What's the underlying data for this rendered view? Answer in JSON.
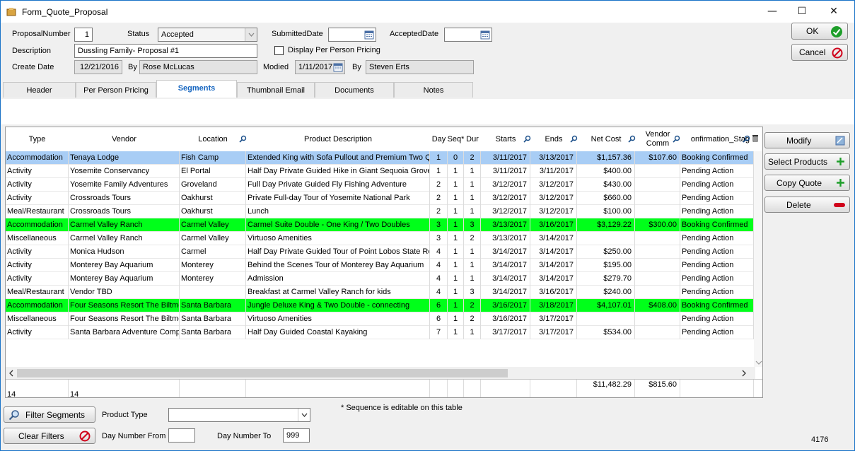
{
  "window": {
    "title": "Form_Quote_Proposal"
  },
  "form": {
    "proposal_number_label": "ProposalNumber",
    "proposal_number": "1",
    "status_label": "Status",
    "status": "Accepted",
    "submitted_label": "SubmittedDate",
    "submitted_value": "",
    "accepted_label": "AcceptedDate",
    "accepted_value": "",
    "description_label": "Description",
    "description": "Dussling Family- Proposal #1",
    "per_person_label": "Display Per Person Pricing",
    "create_date_label": "Create Date",
    "create_date": "12/21/2016",
    "by_label": "By",
    "created_by": "Rose McLucas",
    "modified_label": "Modied",
    "modified_date": "1/11/2017",
    "by2_label": "By",
    "modified_by": "Steven Erts"
  },
  "buttons": {
    "ok": "OK",
    "cancel": "Cancel",
    "modify": "Modify",
    "select_products": "Select Products",
    "copy_quote": "Copy Quote",
    "delete": "Delete",
    "filter_segments": "Filter Segments",
    "clear_filters": "Clear Filters"
  },
  "tabs": [
    {
      "label": "Header"
    },
    {
      "label": "Per Person Pricing"
    },
    {
      "label": "Segments"
    },
    {
      "label": "Thumbnail Email"
    },
    {
      "label": "Documents"
    },
    {
      "label": "Notes"
    }
  ],
  "grid": {
    "headers": {
      "type": "Type",
      "vendor": "Vendor",
      "location": "Location",
      "product": "Product Description",
      "day": "Day",
      "seq": "Seq*",
      "dur": "Dur",
      "starts": "Starts",
      "ends": "Ends",
      "net_cost": "Net Cost",
      "vendor_comm": "Vendor Comm",
      "conf": "onfirmation_Stag"
    },
    "rows": [
      [
        "Accommodation",
        "Tenaya Lodge",
        "Fish Camp",
        "Extended King with Sofa Pullout and Premium Two Queen",
        "1",
        "0",
        "2",
        "3/11/2017",
        "3/13/2017",
        "$1,157.36",
        "$107.60",
        "Booking Confirmed"
      ],
      [
        "Activity",
        "Yosemite Conservancy",
        "El Portal",
        "Half Day Private Guided Hike in Giant Sequoia Grove",
        "1",
        "1",
        "1",
        "3/11/2017",
        "3/11/2017",
        "$400.00",
        "",
        "Pending Action"
      ],
      [
        "Activity",
        "Yosemite Family Adventures",
        "Groveland",
        "Full Day Private Guided Fly Fishing Adventure",
        "2",
        "1",
        "1",
        "3/12/2017",
        "3/12/2017",
        "$430.00",
        "",
        "Pending Action"
      ],
      [
        "Activity",
        "Crossroads Tours",
        "Oakhurst",
        "Private Full-day Tour of Yosemite National Park",
        "2",
        "1",
        "1",
        "3/12/2017",
        "3/12/2017",
        "$660.00",
        "",
        "Pending Action"
      ],
      [
        "Meal/Restaurant",
        "Crossroads Tours",
        "Oakhurst",
        "Lunch",
        "2",
        "1",
        "1",
        "3/12/2017",
        "3/12/2017",
        "$100.00",
        "",
        "Pending Action"
      ],
      [
        "Accommodation",
        "Carmel Valley Ranch",
        "Carmel Valley",
        "Carmel Suite Double - One King / Two Doubles",
        "3",
        "1",
        "3",
        "3/13/2017",
        "3/16/2017",
        "$3,129.22",
        "$300.00",
        "Booking Confirmed"
      ],
      [
        "Miscellaneous",
        "Carmel Valley Ranch",
        "Carmel Valley",
        "Virtuoso Amenities",
        "3",
        "1",
        "2",
        "3/13/2017",
        "3/14/2017",
        "",
        "",
        "Pending Action"
      ],
      [
        "Activity",
        "Monica Hudson",
        "Carmel",
        "Half Day Private Guided Tour of Point Lobos State Reserve",
        "4",
        "1",
        "1",
        "3/14/2017",
        "3/14/2017",
        "$250.00",
        "",
        "Pending Action"
      ],
      [
        "Activity",
        "Monterey Bay Aquarium",
        "Monterey",
        "Behind the Scenes Tour of Monterey Bay Aquarium",
        "4",
        "1",
        "1",
        "3/14/2017",
        "3/14/2017",
        "$195.00",
        "",
        "Pending Action"
      ],
      [
        "Activity",
        "Monterey Bay Aquarium",
        "Monterey",
        "Admission",
        "4",
        "1",
        "1",
        "3/14/2017",
        "3/14/2017",
        "$279.70",
        "",
        "Pending Action"
      ],
      [
        "Meal/Restaurant",
        "Vendor TBD",
        "",
        "Breakfast at Carmel Valley Ranch for kids",
        "4",
        "1",
        "3",
        "3/14/2017",
        "3/16/2017",
        "$240.00",
        "",
        "Pending Action"
      ],
      [
        "Accommodation",
        "Four Seasons Resort The Biltmore",
        "Santa Barbara",
        "Jungle Deluxe King & Two Double - connecting",
        "6",
        "1",
        "2",
        "3/16/2017",
        "3/18/2017",
        "$4,107.01",
        "$408.00",
        "Booking Confirmed"
      ],
      [
        "Miscellaneous",
        "Four Seasons Resort The Biltmore",
        "Santa Barbara",
        "Virtuoso Amenities",
        "6",
        "1",
        "2",
        "3/16/2017",
        "3/17/2017",
        "",
        "",
        "Pending Action"
      ],
      [
        "Activity",
        "Santa Barbara Adventure Company",
        "Santa Barbara",
        "Half Day Guided Coastal Kayaking",
        "7",
        "1",
        "1",
        "3/17/2017",
        "3/17/2017",
        "$534.00",
        "",
        "Pending Action"
      ]
    ],
    "totals": {
      "type_count": "14",
      "vendor_count": "14",
      "net_cost": "$11,482.29",
      "vendor_comm": "$815.60"
    }
  },
  "filters": {
    "product_type_label": "Product Type",
    "product_type_value": "",
    "sequence_note": "* Sequence is editable on this table",
    "day_from_label": "Day Number From",
    "day_from_value": "",
    "day_to_label": "Day Number To",
    "day_to_value": "999"
  },
  "footer": {
    "record_id": "4176"
  },
  "colors": {
    "selected_row": "#a8cdf5",
    "confirmed_row": "#00ff1a",
    "active_tab_text": "#1565c0",
    "ok_green": "#1e9e2a",
    "cancel_red": "#d0021b"
  }
}
